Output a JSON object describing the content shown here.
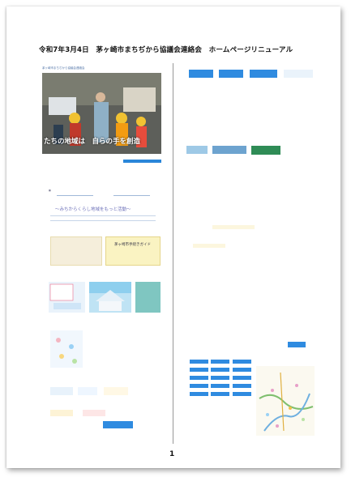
{
  "document": {
    "title": "令和7年3月4日　茅ヶ崎市まちぢから協議会連絡会　ホームページリニューアル",
    "page_number": "1",
    "hero_caption": "たちの地域は　自らの手を創造",
    "hero_tag": "茅ヶ崎市まちぢから協議会連絡会",
    "banner_text": "～みちからくらし地域をもっと活動～",
    "guide_text": "茅ヶ崎市手続きガイド",
    "colors": {
      "accent": "#2f8be0",
      "banner": "#6b6fb8"
    }
  }
}
